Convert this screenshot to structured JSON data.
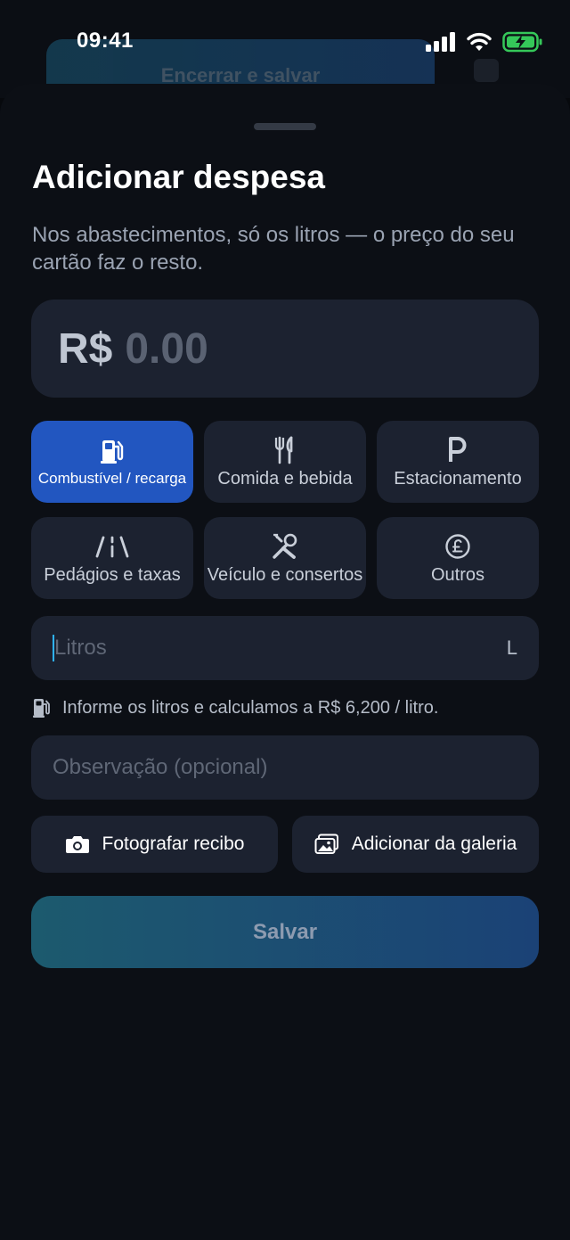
{
  "status_bar": {
    "time": "09:41",
    "battery_color": "#35c759"
  },
  "background_app": {
    "button_label": "Encerrar e salvar"
  },
  "sheet": {
    "title": "Adicionar despesa",
    "subtitle": "Nos abastecimentos, só os litros — o preço do seu cartão faz o resto."
  },
  "amount": {
    "currency": "R$",
    "placeholder": "0.00"
  },
  "categories": [
    {
      "label": "Combustível / recarga",
      "icon": "fuel-pump-icon",
      "selected": true
    },
    {
      "label": "Comida e bebida",
      "icon": "fork-knife-icon",
      "selected": false
    },
    {
      "label": "Estacionamento",
      "icon": "parking-icon",
      "selected": false
    },
    {
      "label": "Pedágios e taxas",
      "icon": "road-icon",
      "selected": false
    },
    {
      "label": "Veículo e consertos",
      "icon": "tools-icon",
      "selected": false
    },
    {
      "label": "Outros",
      "icon": "pound-coin-icon",
      "selected": false
    }
  ],
  "liters": {
    "placeholder": "Litros",
    "unit": "L",
    "value": ""
  },
  "hint": {
    "text": "Informe os litros e calculamos a R$ 6,200 / litro."
  },
  "note": {
    "placeholder": "Observação (opcional)",
    "value": ""
  },
  "media": {
    "camera_label": "Fotografar recibo",
    "gallery_label": "Adicionar da galeria"
  },
  "save_label": "Salvar",
  "colors": {
    "accent_selected": "#2256c0",
    "field_bg": "#1c2230",
    "sheet_bg": "#0c0f15"
  }
}
